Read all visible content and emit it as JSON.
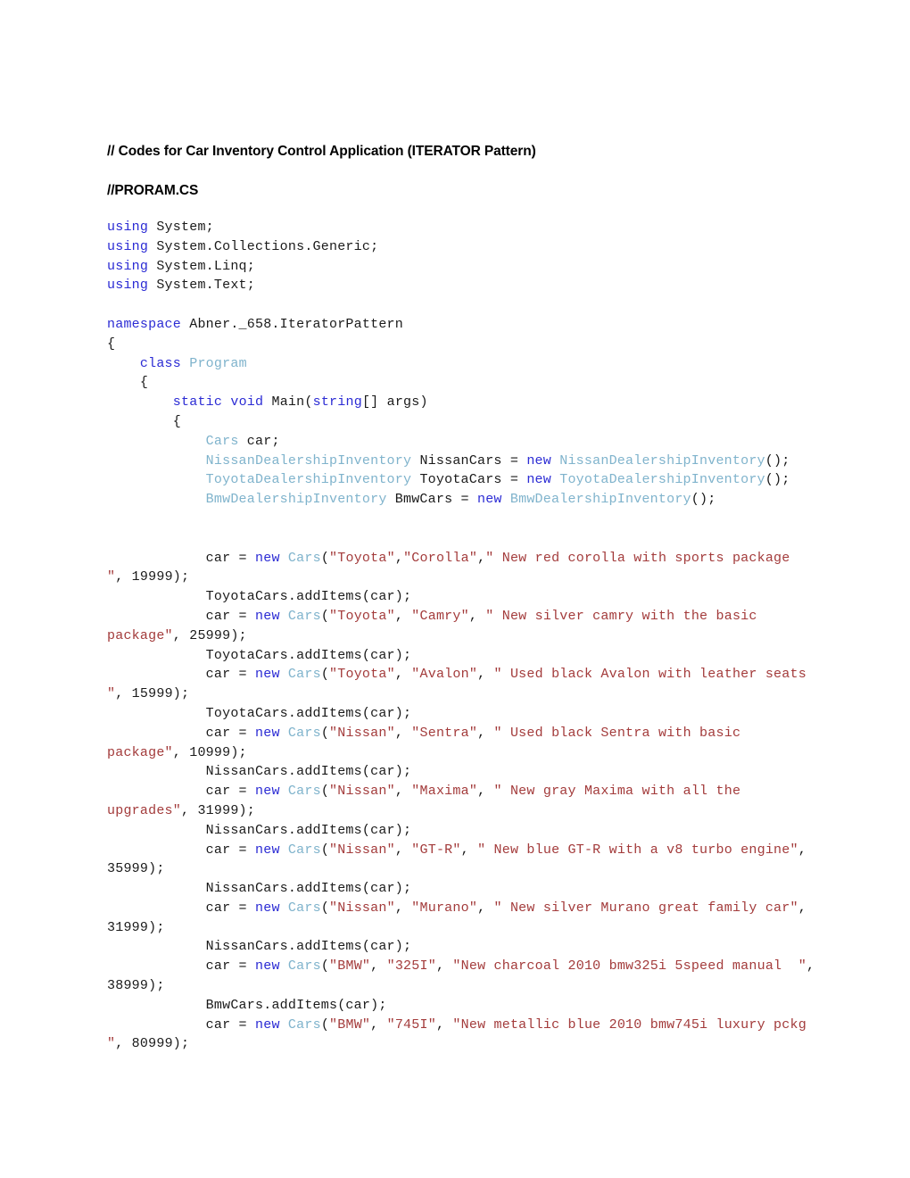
{
  "document": {
    "headings": [
      "// Codes for Car Inventory Control Application (ITERATOR Pattern)",
      "//PRORAM.CS"
    ],
    "syntax_colors": {
      "keyword": "#2b2bd4",
      "type": "#7fb3cc",
      "string": "#a33b3b",
      "plain": "#1a1a1a",
      "background": "#ffffff"
    },
    "code_lines": [
      {
        "id": "l01",
        "tokens": [
          {
            "t": "kw",
            "v": "using"
          },
          {
            "t": "pln",
            "v": " System;"
          }
        ]
      },
      {
        "id": "l02",
        "tokens": [
          {
            "t": "kw",
            "v": "using"
          },
          {
            "t": "pln",
            "v": " System.Collections.Generic;"
          }
        ]
      },
      {
        "id": "l03",
        "tokens": [
          {
            "t": "kw",
            "v": "using"
          },
          {
            "t": "pln",
            "v": " System.Linq;"
          }
        ]
      },
      {
        "id": "l04",
        "tokens": [
          {
            "t": "kw",
            "v": "using"
          },
          {
            "t": "pln",
            "v": " System.Text;"
          }
        ]
      },
      {
        "id": "l05",
        "tokens": []
      },
      {
        "id": "l06",
        "tokens": [
          {
            "t": "kw",
            "v": "namespace"
          },
          {
            "t": "pln",
            "v": " Abner._658.IteratorPattern"
          }
        ]
      },
      {
        "id": "l07",
        "tokens": [
          {
            "t": "pln",
            "v": "{"
          }
        ]
      },
      {
        "id": "l08",
        "tokens": [
          {
            "t": "pln",
            "v": "    "
          },
          {
            "t": "kw",
            "v": "class"
          },
          {
            "t": "pln",
            "v": " "
          },
          {
            "t": "typ",
            "v": "Program"
          }
        ]
      },
      {
        "id": "l09",
        "tokens": [
          {
            "t": "pln",
            "v": "    {"
          }
        ]
      },
      {
        "id": "l10",
        "tokens": [
          {
            "t": "pln",
            "v": "        "
          },
          {
            "t": "kw",
            "v": "static"
          },
          {
            "t": "pln",
            "v": " "
          },
          {
            "t": "kw",
            "v": "void"
          },
          {
            "t": "pln",
            "v": " Main("
          },
          {
            "t": "kw",
            "v": "string"
          },
          {
            "t": "pln",
            "v": "[] args)"
          }
        ]
      },
      {
        "id": "l11",
        "tokens": [
          {
            "t": "pln",
            "v": "        {"
          }
        ]
      },
      {
        "id": "l12",
        "tokens": [
          {
            "t": "pln",
            "v": "            "
          },
          {
            "t": "typ",
            "v": "Cars"
          },
          {
            "t": "pln",
            "v": " car;"
          }
        ]
      },
      {
        "id": "l13",
        "tokens": [
          {
            "t": "pln",
            "v": "            "
          },
          {
            "t": "typ",
            "v": "NissanDealershipInventory"
          },
          {
            "t": "pln",
            "v": " NissanCars = "
          },
          {
            "t": "kw",
            "v": "new"
          },
          {
            "t": "pln",
            "v": " "
          },
          {
            "t": "typ",
            "v": "NissanDealershipInventory"
          },
          {
            "t": "pln",
            "v": "();"
          }
        ]
      },
      {
        "id": "l14",
        "tokens": [
          {
            "t": "pln",
            "v": "            "
          },
          {
            "t": "typ",
            "v": "ToyotaDealershipInventory"
          },
          {
            "t": "pln",
            "v": " ToyotaCars = "
          },
          {
            "t": "kw",
            "v": "new"
          },
          {
            "t": "pln",
            "v": " "
          },
          {
            "t": "typ",
            "v": "ToyotaDealershipInventory"
          },
          {
            "t": "pln",
            "v": "();"
          }
        ]
      },
      {
        "id": "l15",
        "tokens": [
          {
            "t": "pln",
            "v": "            "
          },
          {
            "t": "typ",
            "v": "BmwDealershipInventory"
          },
          {
            "t": "pln",
            "v": " BmwCars = "
          },
          {
            "t": "kw",
            "v": "new"
          },
          {
            "t": "pln",
            "v": " "
          },
          {
            "t": "typ",
            "v": "BmwDealershipInventory"
          },
          {
            "t": "pln",
            "v": "();"
          }
        ]
      },
      {
        "id": "l16",
        "tokens": []
      },
      {
        "id": "l17",
        "tokens": []
      },
      {
        "id": "l18",
        "tokens": [
          {
            "t": "pln",
            "v": "            car = "
          },
          {
            "t": "kw",
            "v": "new"
          },
          {
            "t": "pln",
            "v": " "
          },
          {
            "t": "typ",
            "v": "Cars"
          },
          {
            "t": "pln",
            "v": "("
          },
          {
            "t": "str",
            "v": "\"Toyota\""
          },
          {
            "t": "pln",
            "v": ","
          },
          {
            "t": "str",
            "v": "\"Corolla\""
          },
          {
            "t": "pln",
            "v": ","
          },
          {
            "t": "str",
            "v": "\" New red corolla with sports package  \""
          },
          {
            "t": "pln",
            "v": ", 19999);"
          }
        ]
      },
      {
        "id": "l19",
        "tokens": [
          {
            "t": "pln",
            "v": "            ToyotaCars.addItems(car);"
          }
        ]
      },
      {
        "id": "l20",
        "tokens": [
          {
            "t": "pln",
            "v": "            car = "
          },
          {
            "t": "kw",
            "v": "new"
          },
          {
            "t": "pln",
            "v": " "
          },
          {
            "t": "typ",
            "v": "Cars"
          },
          {
            "t": "pln",
            "v": "("
          },
          {
            "t": "str",
            "v": "\"Toyota\""
          },
          {
            "t": "pln",
            "v": ", "
          },
          {
            "t": "str",
            "v": "\"Camry\""
          },
          {
            "t": "pln",
            "v": ", "
          },
          {
            "t": "str",
            "v": "\" New silver camry with the basic package\""
          },
          {
            "t": "pln",
            "v": ", 25999);"
          }
        ]
      },
      {
        "id": "l21",
        "tokens": [
          {
            "t": "pln",
            "v": "            ToyotaCars.addItems(car);"
          }
        ]
      },
      {
        "id": "l22",
        "tokens": [
          {
            "t": "pln",
            "v": "            car = "
          },
          {
            "t": "kw",
            "v": "new"
          },
          {
            "t": "pln",
            "v": " "
          },
          {
            "t": "typ",
            "v": "Cars"
          },
          {
            "t": "pln",
            "v": "("
          },
          {
            "t": "str",
            "v": "\"Toyota\""
          },
          {
            "t": "pln",
            "v": ", "
          },
          {
            "t": "str",
            "v": "\"Avalon\""
          },
          {
            "t": "pln",
            "v": ", "
          },
          {
            "t": "str",
            "v": "\" Used black Avalon with leather seats  \""
          },
          {
            "t": "pln",
            "v": ", 15999);"
          }
        ]
      },
      {
        "id": "l23",
        "tokens": [
          {
            "t": "pln",
            "v": "            ToyotaCars.addItems(car);"
          }
        ]
      },
      {
        "id": "l24",
        "tokens": [
          {
            "t": "pln",
            "v": "            car = "
          },
          {
            "t": "kw",
            "v": "new"
          },
          {
            "t": "pln",
            "v": " "
          },
          {
            "t": "typ",
            "v": "Cars"
          },
          {
            "t": "pln",
            "v": "("
          },
          {
            "t": "str",
            "v": "\"Nissan\""
          },
          {
            "t": "pln",
            "v": ", "
          },
          {
            "t": "str",
            "v": "\"Sentra\""
          },
          {
            "t": "pln",
            "v": ", "
          },
          {
            "t": "str",
            "v": "\" Used black Sentra with basic package\""
          },
          {
            "t": "pln",
            "v": ", 10999);"
          }
        ]
      },
      {
        "id": "l25",
        "tokens": [
          {
            "t": "pln",
            "v": "            NissanCars.addItems(car);"
          }
        ]
      },
      {
        "id": "l26",
        "tokens": [
          {
            "t": "pln",
            "v": "            car = "
          },
          {
            "t": "kw",
            "v": "new"
          },
          {
            "t": "pln",
            "v": " "
          },
          {
            "t": "typ",
            "v": "Cars"
          },
          {
            "t": "pln",
            "v": "("
          },
          {
            "t": "str",
            "v": "\"Nissan\""
          },
          {
            "t": "pln",
            "v": ", "
          },
          {
            "t": "str",
            "v": "\"Maxima\""
          },
          {
            "t": "pln",
            "v": ", "
          },
          {
            "t": "str",
            "v": "\" New gray Maxima with all the upgrades\""
          },
          {
            "t": "pln",
            "v": ", 31999);"
          }
        ]
      },
      {
        "id": "l27",
        "tokens": [
          {
            "t": "pln",
            "v": "            NissanCars.addItems(car);"
          }
        ]
      },
      {
        "id": "l28",
        "tokens": [
          {
            "t": "pln",
            "v": "            car = "
          },
          {
            "t": "kw",
            "v": "new"
          },
          {
            "t": "pln",
            "v": " "
          },
          {
            "t": "typ",
            "v": "Cars"
          },
          {
            "t": "pln",
            "v": "("
          },
          {
            "t": "str",
            "v": "\"Nissan\""
          },
          {
            "t": "pln",
            "v": ", "
          },
          {
            "t": "str",
            "v": "\"GT-R\""
          },
          {
            "t": "pln",
            "v": ", "
          },
          {
            "t": "str",
            "v": "\" New blue GT-R with a v8 turbo engine\""
          },
          {
            "t": "pln",
            "v": ", 35999);"
          }
        ]
      },
      {
        "id": "l29",
        "tokens": [
          {
            "t": "pln",
            "v": "            NissanCars.addItems(car);"
          }
        ]
      },
      {
        "id": "l30",
        "tokens": [
          {
            "t": "pln",
            "v": "            car = "
          },
          {
            "t": "kw",
            "v": "new"
          },
          {
            "t": "pln",
            "v": " "
          },
          {
            "t": "typ",
            "v": "Cars"
          },
          {
            "t": "pln",
            "v": "("
          },
          {
            "t": "str",
            "v": "\"Nissan\""
          },
          {
            "t": "pln",
            "v": ", "
          },
          {
            "t": "str",
            "v": "\"Murano\""
          },
          {
            "t": "pln",
            "v": ", "
          },
          {
            "t": "str",
            "v": "\" New silver Murano great family car\""
          },
          {
            "t": "pln",
            "v": ", 31999);"
          }
        ]
      },
      {
        "id": "l31",
        "tokens": [
          {
            "t": "pln",
            "v": "            NissanCars.addItems(car);"
          }
        ]
      },
      {
        "id": "l32",
        "tokens": [
          {
            "t": "pln",
            "v": "            car = "
          },
          {
            "t": "kw",
            "v": "new"
          },
          {
            "t": "pln",
            "v": " "
          },
          {
            "t": "typ",
            "v": "Cars"
          },
          {
            "t": "pln",
            "v": "("
          },
          {
            "t": "str",
            "v": "\"BMW\""
          },
          {
            "t": "pln",
            "v": ", "
          },
          {
            "t": "str",
            "v": "\"325I\""
          },
          {
            "t": "pln",
            "v": ", "
          },
          {
            "t": "str",
            "v": "\"New charcoal 2010 bmw325i 5speed manual  \""
          },
          {
            "t": "pln",
            "v": ", 38999);"
          }
        ]
      },
      {
        "id": "l33",
        "tokens": [
          {
            "t": "pln",
            "v": "            BmwCars.addItems(car);"
          }
        ]
      },
      {
        "id": "l34",
        "tokens": [
          {
            "t": "pln",
            "v": "            car = "
          },
          {
            "t": "kw",
            "v": "new"
          },
          {
            "t": "pln",
            "v": " "
          },
          {
            "t": "typ",
            "v": "Cars"
          },
          {
            "t": "pln",
            "v": "("
          },
          {
            "t": "str",
            "v": "\"BMW\""
          },
          {
            "t": "pln",
            "v": ", "
          },
          {
            "t": "str",
            "v": "\"745I\""
          },
          {
            "t": "pln",
            "v": ", "
          },
          {
            "t": "str",
            "v": "\"New metallic blue 2010 bmw745i luxury pckg \""
          },
          {
            "t": "pln",
            "v": ", 80999);"
          }
        ]
      }
    ]
  }
}
